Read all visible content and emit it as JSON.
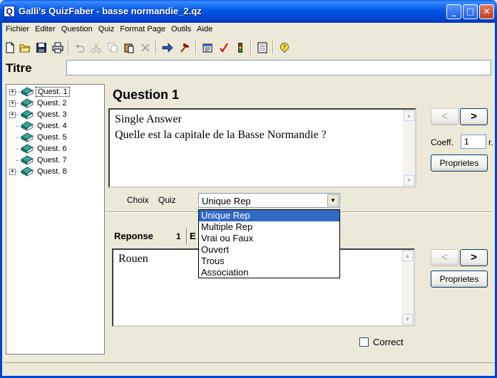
{
  "window": {
    "title": "Galli's QuizFaber - basse normandie_2.qz",
    "icon_letter": "Q"
  },
  "menu": [
    "Fichier",
    "Editer",
    "Question",
    "Quiz",
    "Format Page",
    "Outils",
    "Aide"
  ],
  "toolbar_icons": [
    "new-icon",
    "open-icon",
    "save-icon",
    "print-icon",
    "undo-icon",
    "cut-icon",
    "copy-icon",
    "paste-icon",
    "delete-icon",
    "forward-icon",
    "hammer-icon",
    "properties-icon",
    "check-icon",
    "traffic-light-icon",
    "list-icon",
    "help-icon"
  ],
  "titre": {
    "label": "Titre",
    "value": ""
  },
  "tree": [
    {
      "label": "Quest. 1",
      "expandable": true,
      "selected": true
    },
    {
      "label": "Quest. 2",
      "expandable": true
    },
    {
      "label": "Quest. 3",
      "expandable": true
    },
    {
      "label": "Quest. 4",
      "expandable": false
    },
    {
      "label": "Quest. 5",
      "expandable": false
    },
    {
      "label": "Quest. 6",
      "expandable": false
    },
    {
      "label": "Quest. 7",
      "expandable": false
    },
    {
      "label": "Quest. 8",
      "expandable": true
    }
  ],
  "question": {
    "title": "Question 1",
    "text": "Single Answer\nQuelle est la capitale de la Basse Normandie ?",
    "prev": "<",
    "next": ">",
    "coeff_label": "Coeff.",
    "coeff_value": "1",
    "coeff_suffix": "r.",
    "props": "Proprietes"
  },
  "choix": {
    "label1": "Choix",
    "label2": "Quiz",
    "selected": "Unique Rep",
    "options": [
      "Unique Rep",
      "Multiple Rep",
      "Vrai ou Faux",
      "Ouvert",
      "Trous",
      "Association"
    ]
  },
  "reponse": {
    "tab_label": "Reponse",
    "tab_number": "1",
    "tab_next": "E",
    "text": "Rouen",
    "prev": "<",
    "next": ">",
    "props": "Proprietes",
    "correct_label": "Correct"
  }
}
